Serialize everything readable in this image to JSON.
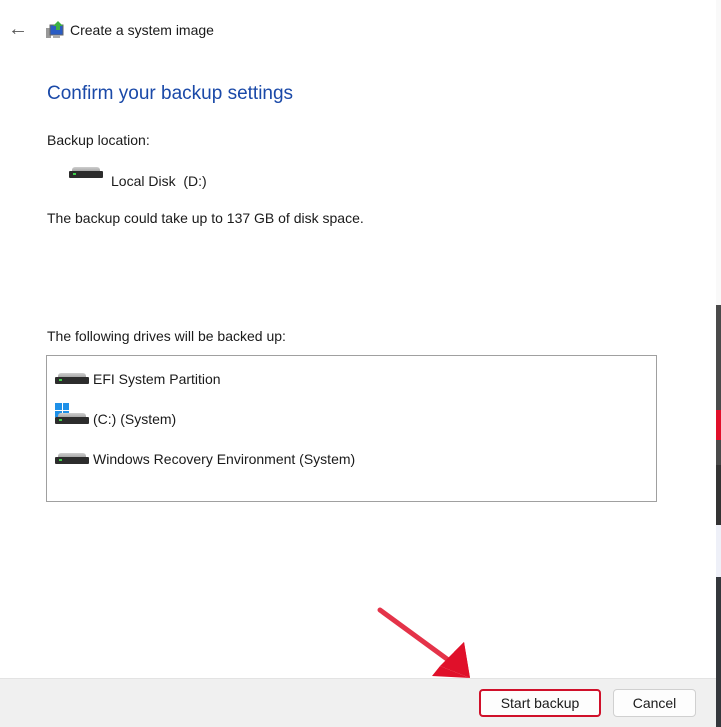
{
  "window": {
    "title": "Create a system image",
    "back_icon": "arrow-left-icon"
  },
  "heading": "Confirm your backup settings",
  "backup_location_label": "Backup location:",
  "backup_location": "Local Disk  (D:)",
  "space_note": "The backup could take up to 137 GB of disk space.",
  "drives_label": "The following drives will be backed up:",
  "drives": [
    {
      "name": "EFI System Partition",
      "icon": "drive-icon"
    },
    {
      "name": "(C:) (System)",
      "icon": "windows-drive-icon"
    },
    {
      "name": "Windows Recovery Environment (System)",
      "icon": "drive-icon"
    }
  ],
  "buttons": {
    "start": "Start backup",
    "cancel": "Cancel"
  },
  "colors": {
    "heading": "#1a49a8",
    "highlight": "#d0102a",
    "footer": "#f0f0f0"
  }
}
